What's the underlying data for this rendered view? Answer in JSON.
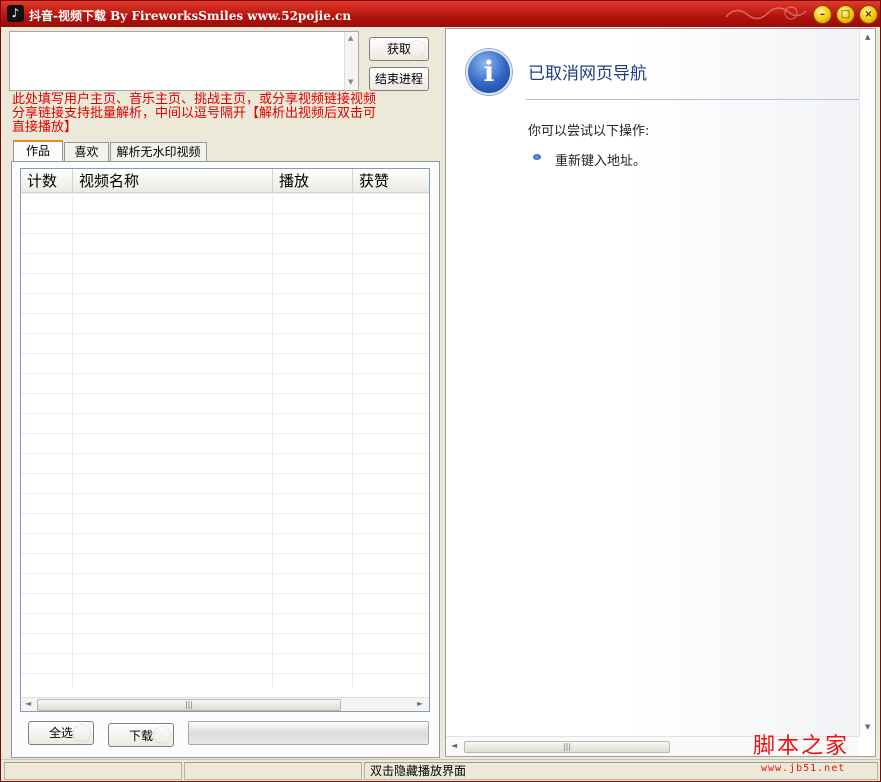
{
  "window": {
    "title": "抖音-视频下载 By FireworksSmiles www.52pojie.cn",
    "app_icon": "tiktok-note-icon",
    "accent_color": "#b3120c"
  },
  "controls": {
    "url_input_value": "",
    "fetch_label": "获取",
    "stop_label": "结束进程",
    "hint_text": "此处填写用户主页、音乐主页、挑战主页，或分享视频链接视频分享链接支持批量解析，中间以逗号隔开【解析出视频后双击可直接播放】"
  },
  "tabs": [
    {
      "label": "作品",
      "active": true
    },
    {
      "label": "喜欢",
      "active": false
    },
    {
      "label": "解析无水印视频",
      "active": false
    }
  ],
  "table": {
    "columns": [
      "计数",
      "视频名称",
      "播放",
      "获赞"
    ],
    "rows": []
  },
  "actions": {
    "select_all_label": "全选",
    "download_label": "下载",
    "progress": 0
  },
  "browser": {
    "icon": "info-icon",
    "title": "已取消网页导航",
    "subtitle": "你可以尝试以下操作:",
    "actions": [
      "重新键入地址。"
    ]
  },
  "statusbar": {
    "cells": [
      "",
      "",
      "双击隐藏播放界面"
    ]
  },
  "watermark": {
    "text": "脚本之家",
    "sub": "www.jb51.net"
  }
}
